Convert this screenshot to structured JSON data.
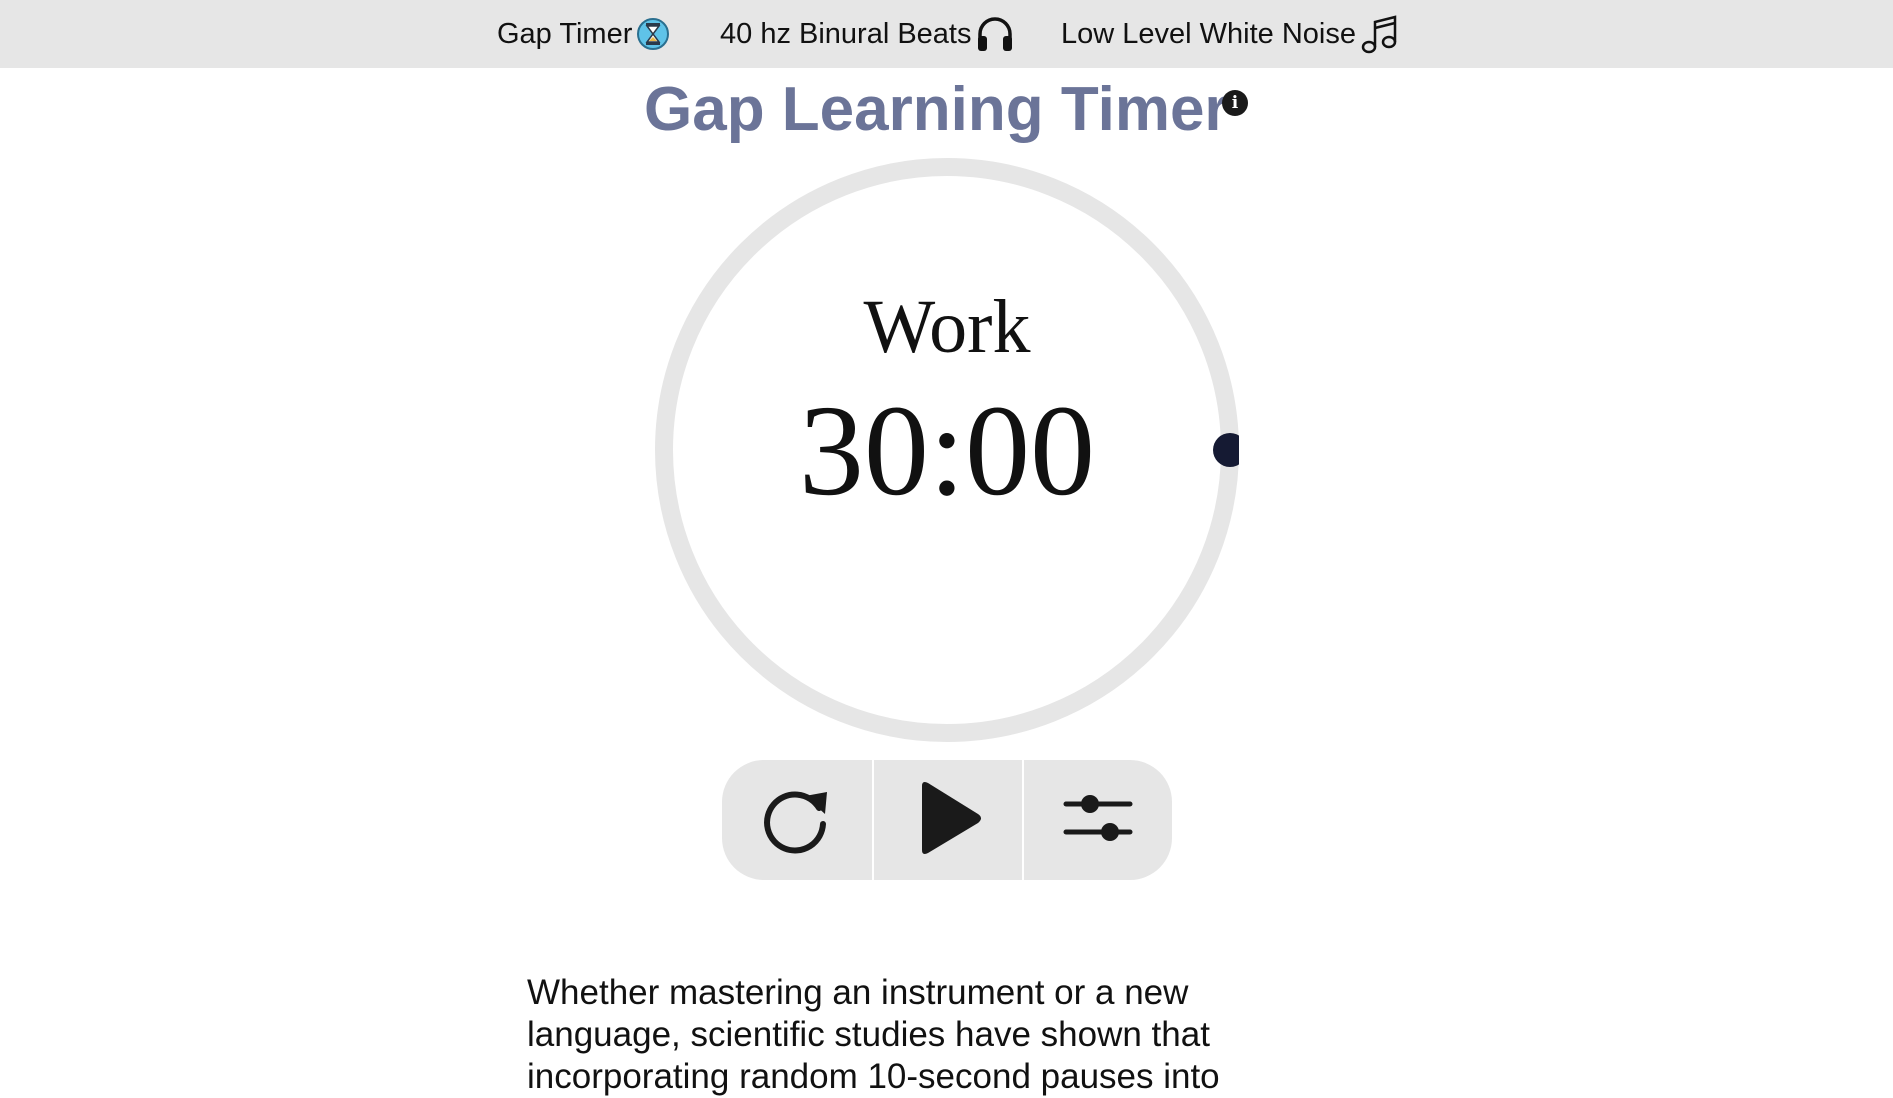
{
  "nav": {
    "items": [
      {
        "label": "Gap Timer",
        "icon": "hourglass-icon"
      },
      {
        "label": "40 hz Binural Beats",
        "icon": "headphones-icon"
      },
      {
        "label": "Low Level White Noise",
        "icon": "music-note-icon"
      }
    ]
  },
  "page": {
    "title": "Gap Learning Timer",
    "info_icon": "info-icon"
  },
  "timer": {
    "mode": "Work",
    "time": "30:00",
    "progress": 0
  },
  "controls": {
    "restart_icon": "restart-icon",
    "play_icon": "play-icon",
    "settings_icon": "sliders-icon"
  },
  "description": {
    "text": "Whether mastering an instrument or a new language, scientific studies have shown that incorporating random 10-second pauses into"
  },
  "colors": {
    "nav_bg": "#e6e6e6",
    "title": "#6b7498",
    "ring": "#e6e6e6",
    "knob": "#151a33",
    "controls_bg": "#e6e6e6"
  }
}
